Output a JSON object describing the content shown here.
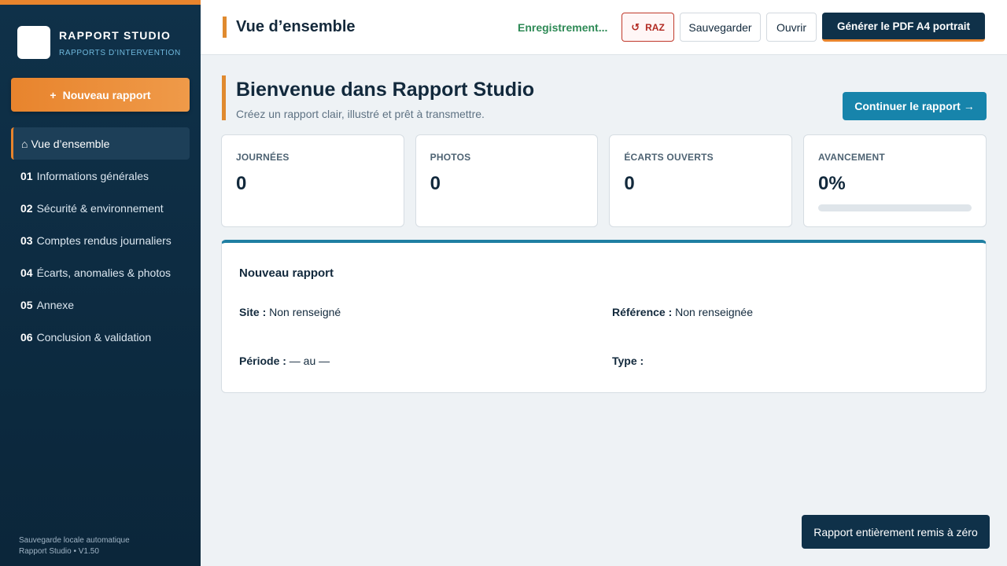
{
  "sidebar": {
    "brand_title": "RAPPORT STUDIO",
    "brand_subtitle": "RAPPORTS D'INTERVENTION",
    "new_report_label": "Nouveau rapport",
    "items": [
      {
        "num": "",
        "label": "Vue d’ensemble",
        "active": true
      },
      {
        "num": "01",
        "label": "Informations générales"
      },
      {
        "num": "02",
        "label": "Sécurité & environnement"
      },
      {
        "num": "03",
        "label": "Comptes rendus journaliers"
      },
      {
        "num": "04",
        "label": "Écarts, anomalies & photos"
      },
      {
        "num": "05",
        "label": "Annexe"
      },
      {
        "num": "06",
        "label": "Conclusion & validation"
      }
    ],
    "footer_line1": "Sauvegarde locale automatique",
    "footer_line2": "Rapport Studio • V1.50"
  },
  "topbar": {
    "title": "Vue d’ensemble",
    "saving_status": "Enregistrement...",
    "raz_label": "RAZ",
    "save_label": "Sauvegarder",
    "open_label": "Ouvrir",
    "pdf_label": "Générer le PDF A4 portrait"
  },
  "welcome": {
    "title": "Bienvenue dans Rapport Studio",
    "subtitle": "Créez un rapport clair, illustré et prêt à transmettre.",
    "continue_label": "Continuer le rapport →"
  },
  "stats": [
    {
      "label": "JOURNÉES",
      "value": "0"
    },
    {
      "label": "PHOTOS",
      "value": "0"
    },
    {
      "label": "ÉCARTS OUVERTS",
      "value": "0"
    },
    {
      "label": "AVANCEMENT",
      "value": "0%",
      "progress": 0
    }
  ],
  "report": {
    "title": "Nouveau rapport",
    "site_label": "Site :",
    "site_value": "Non renseigné",
    "ref_label": "Référence :",
    "ref_value": "Non renseignée",
    "period_label": "Période :",
    "period_value": "— au —",
    "type_label": "Type :",
    "type_value": ""
  },
  "toast": "Rapport entièrement remis à zéro",
  "colors": {
    "accent": "#e8842d",
    "primary": "#0f3149",
    "action": "#1784ab",
    "danger": "#b22a22",
    "success": "#2e8a56"
  }
}
